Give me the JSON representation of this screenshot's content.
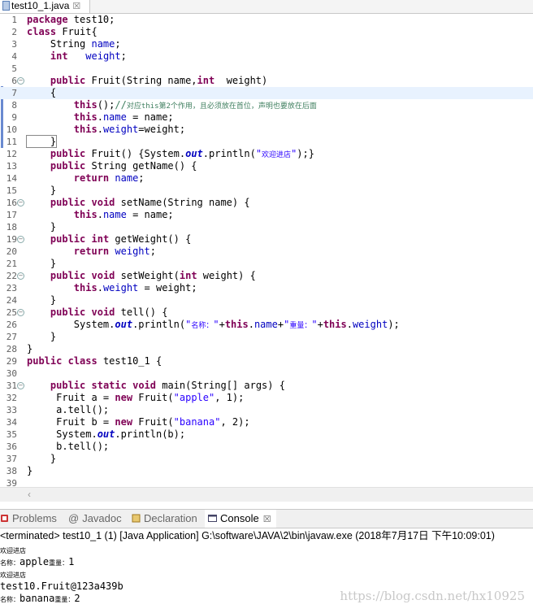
{
  "editor_tab": {
    "label": "test10_1.java",
    "close": "☒"
  },
  "code_lines": [
    [
      [
        "kw",
        "package"
      ],
      [
        "t",
        " test10;"
      ]
    ],
    [
      [
        "kw",
        "class"
      ],
      [
        "t",
        " Fruit{"
      ]
    ],
    [
      [
        "t",
        "    String "
      ],
      [
        "fld",
        "name"
      ],
      [
        "t",
        ";"
      ]
    ],
    [
      [
        "t",
        "    "
      ],
      [
        "kw",
        "int"
      ],
      [
        "t",
        "   "
      ],
      [
        "fld",
        "weight"
      ],
      [
        "t",
        ";"
      ]
    ],
    [],
    [
      [
        "t",
        "    "
      ],
      [
        "kw",
        "public"
      ],
      [
        "t",
        " Fruit(String name,"
      ],
      [
        "kw",
        "int"
      ],
      [
        "t",
        "  weight)"
      ]
    ],
    [
      [
        "t",
        "    {"
      ]
    ],
    [
      [
        "t",
        "        "
      ],
      [
        "kw",
        "this"
      ],
      [
        "t",
        "();"
      ],
      [
        "cmt",
        "//"
      ],
      [
        "cmtn",
        "对应this第2个作用，且必须放在首位，声明也要放在后面"
      ]
    ],
    [
      [
        "t",
        "        "
      ],
      [
        "kw",
        "this"
      ],
      [
        "t",
        "."
      ],
      [
        "fld",
        "name"
      ],
      [
        "t",
        " = name;"
      ]
    ],
    [
      [
        "t",
        "        "
      ],
      [
        "kw",
        "this"
      ],
      [
        "t",
        "."
      ],
      [
        "fld",
        "weight"
      ],
      [
        "t",
        "=weight;"
      ]
    ],
    [
      [
        "brk",
        "    }"
      ]
    ],
    [
      [
        "t",
        "    "
      ],
      [
        "kw",
        "public"
      ],
      [
        "t",
        " Fruit() {System."
      ],
      [
        "st",
        "out"
      ],
      [
        "t",
        ".println("
      ],
      [
        "str",
        "\""
      ],
      [
        "strs",
        "欢迎进店"
      ],
      [
        "str",
        "\""
      ],
      [
        "t",
        ");}"
      ]
    ],
    [
      [
        "t",
        "    "
      ],
      [
        "kw",
        "public"
      ],
      [
        "t",
        " String getName() {"
      ]
    ],
    [
      [
        "t",
        "        "
      ],
      [
        "kw",
        "return"
      ],
      [
        "t",
        " "
      ],
      [
        "fld",
        "name"
      ],
      [
        "t",
        ";"
      ]
    ],
    [
      [
        "t",
        "    }"
      ]
    ],
    [
      [
        "t",
        "    "
      ],
      [
        "kw",
        "public"
      ],
      [
        "t",
        " "
      ],
      [
        "kw",
        "void"
      ],
      [
        "t",
        " setName(String name) {"
      ]
    ],
    [
      [
        "t",
        "        "
      ],
      [
        "kw",
        "this"
      ],
      [
        "t",
        "."
      ],
      [
        "fld",
        "name"
      ],
      [
        "t",
        " = name;"
      ]
    ],
    [
      [
        "t",
        "    }"
      ]
    ],
    [
      [
        "t",
        "    "
      ],
      [
        "kw",
        "public"
      ],
      [
        "t",
        " "
      ],
      [
        "kw",
        "int"
      ],
      [
        "t",
        " getWeight() {"
      ]
    ],
    [
      [
        "t",
        "        "
      ],
      [
        "kw",
        "return"
      ],
      [
        "t",
        " "
      ],
      [
        "fld",
        "weight"
      ],
      [
        "t",
        ";"
      ]
    ],
    [
      [
        "t",
        "    }"
      ]
    ],
    [
      [
        "t",
        "    "
      ],
      [
        "kw",
        "public"
      ],
      [
        "t",
        " "
      ],
      [
        "kw",
        "void"
      ],
      [
        "t",
        " setWeight("
      ],
      [
        "kw",
        "int"
      ],
      [
        "t",
        " weight) {"
      ]
    ],
    [
      [
        "t",
        "        "
      ],
      [
        "kw",
        "this"
      ],
      [
        "t",
        "."
      ],
      [
        "fld",
        "weight"
      ],
      [
        "t",
        " = weight;"
      ]
    ],
    [
      [
        "t",
        "    }"
      ]
    ],
    [
      [
        "t",
        "    "
      ],
      [
        "kw",
        "public"
      ],
      [
        "t",
        " "
      ],
      [
        "kw",
        "void"
      ],
      [
        "t",
        " tell() {"
      ]
    ],
    [
      [
        "t",
        "        System."
      ],
      [
        "st",
        "out"
      ],
      [
        "t",
        ".println("
      ],
      [
        "str",
        "\""
      ],
      [
        "strs",
        "名称："
      ],
      [
        "str",
        "\""
      ],
      [
        "t",
        "+"
      ],
      [
        "kw",
        "this"
      ],
      [
        "t",
        "."
      ],
      [
        "fld",
        "name"
      ],
      [
        "t",
        "+"
      ],
      [
        "str",
        "\""
      ],
      [
        "strs",
        "重量："
      ],
      [
        "str",
        "\""
      ],
      [
        "t",
        "+"
      ],
      [
        "kw",
        "this"
      ],
      [
        "t",
        "."
      ],
      [
        "fld",
        "weight"
      ],
      [
        "t",
        ");"
      ]
    ],
    [
      [
        "t",
        "    }"
      ]
    ],
    [
      [
        "t",
        "}"
      ]
    ],
    [
      [
        "kw",
        "public"
      ],
      [
        "t",
        " "
      ],
      [
        "kw",
        "class"
      ],
      [
        "t",
        " test10_1 {"
      ]
    ],
    [],
    [
      [
        "t",
        "    "
      ],
      [
        "kw",
        "public"
      ],
      [
        "t",
        " "
      ],
      [
        "kw",
        "static"
      ],
      [
        "t",
        " "
      ],
      [
        "kw",
        "void"
      ],
      [
        "t",
        " main(String[] args) {"
      ]
    ],
    [
      [
        "t",
        "     Fruit a = "
      ],
      [
        "kw",
        "new"
      ],
      [
        "t",
        " Fruit("
      ],
      [
        "str",
        "\"apple\""
      ],
      [
        "t",
        ", 1);"
      ]
    ],
    [
      [
        "t",
        "     a.tell();"
      ]
    ],
    [
      [
        "t",
        "     Fruit b = "
      ],
      [
        "kw",
        "new"
      ],
      [
        "t",
        " Fruit("
      ],
      [
        "str",
        "\"banana\""
      ],
      [
        "t",
        ", 2);"
      ]
    ],
    [
      [
        "t",
        "     System."
      ],
      [
        "st",
        "out"
      ],
      [
        "t",
        ".println(b);"
      ]
    ],
    [
      [
        "t",
        "     b.tell();"
      ]
    ],
    [
      [
        "t",
        "    }"
      ]
    ],
    [
      [
        "t",
        "}"
      ]
    ],
    []
  ],
  "panel_tabs": [
    "Problems",
    "Javadoc",
    "Declaration",
    "Console"
  ],
  "console_close": "☒",
  "console_status": "<terminated> test10_1 (1) [Java Application] G:\\software\\JAVA\\2\\bin\\javaw.exe (2018年7月17日 下午10:09:01)",
  "console_lines": [
    [
      [
        "s",
        "欢迎进店"
      ]
    ],
    [
      [
        "s",
        "名称："
      ],
      [
        "n",
        "apple"
      ],
      [
        "s",
        "重量："
      ],
      [
        "n",
        "1"
      ]
    ],
    [
      [
        "s",
        "欢迎进店"
      ]
    ],
    [
      [
        "n",
        "test10.Fruit@123a439b"
      ]
    ],
    [
      [
        "s",
        "名称："
      ],
      [
        "n",
        "banana"
      ],
      [
        "s",
        "重量："
      ],
      [
        "n",
        "2"
      ]
    ]
  ],
  "watermark": "https://blog.csdn.net/hx10925",
  "colors": {
    "keyword": "#7f0055",
    "field": "#0000c0",
    "string": "#2a00ff",
    "comment": "#3f7f5f",
    "current_line": "#e8f2fe"
  }
}
